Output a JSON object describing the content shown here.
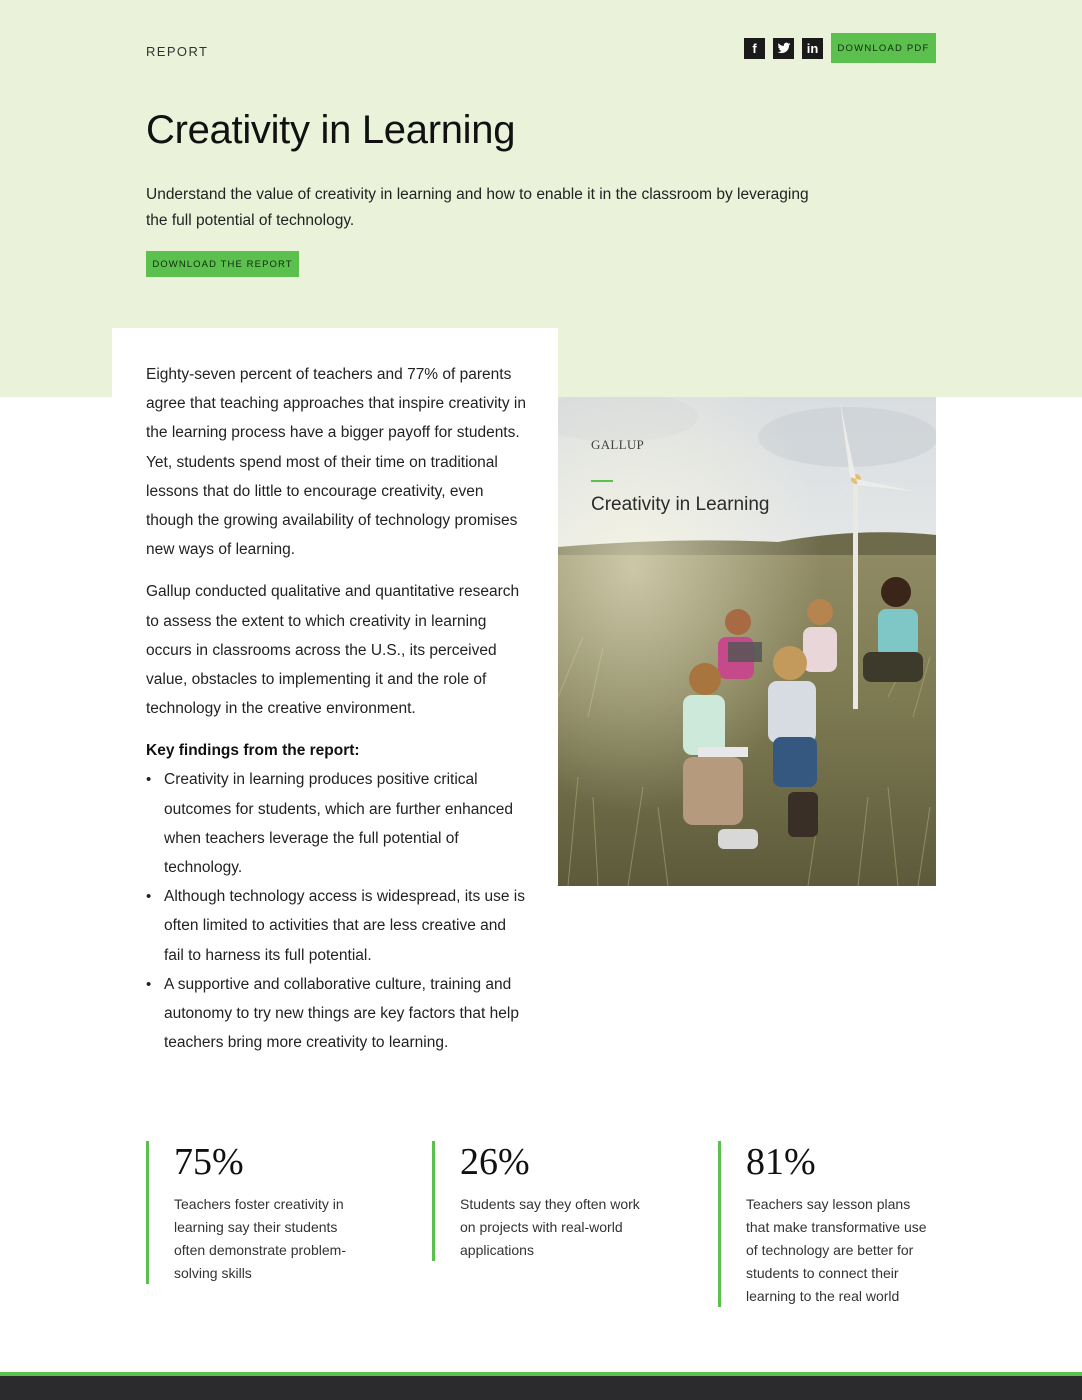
{
  "header": {
    "eyebrow": "REPORT",
    "social": [
      {
        "label": "f",
        "icon": "facebook-icon"
      },
      {
        "label": "twitter",
        "icon": "twitter-icon"
      },
      {
        "label": "in",
        "icon": "linkedin-icon"
      }
    ],
    "download_pdf_label": "DOWNLOAD PDF"
  },
  "hero": {
    "title": "Creativity in Learning",
    "intro": "Understand the value of creativity in learning and how to enable it in the classroom by leveraging the full potential of technology.",
    "download_report_label": "DOWNLOAD THE REPORT"
  },
  "body": {
    "paragraphs": [
      "Eighty-seven percent of teachers and 77% of parents agree that teaching approaches that inspire creativity in the learning process have a bigger payoff for students. Yet, students spend most of their time on traditional lessons that do little to encourage creativity, even though the growing availability of technology promises new ways of learning.",
      "Gallup conducted qualitative and quantitative research to assess the extent to which creativity in learning occurs in classrooms across the U.S., its perceived value, obstacles to implementing it and the role of technology in the creative environment."
    ],
    "findings_heading": "Key findings from the report:",
    "findings": [
      "Creativity in learning produces positive critical outcomes for students, which are further enhanced when teachers leverage the full potential of technology.",
      "Although technology access is widespread, its use is often limited to activities that are less creative and fail to harness its full potential.",
      "A supportive and collaborative culture, training and autonomy to try new things are key factors that help teachers bring more creativity to learning."
    ]
  },
  "cover": {
    "brand": "GALLUP",
    "title": "Creativity in Learning"
  },
  "stats": [
    {
      "value": "75%",
      "description": "Teachers foster creativity in learning say their students often demonstrate problem-solving skills"
    },
    {
      "value": "26%",
      "description": "Students say they often work on projects with real-world applications"
    },
    {
      "value": "81%",
      "description": "Teachers say lesson plans that make transformative use of technology are better for students to connect their learning to the real world"
    }
  ],
  "colors": {
    "hero_bg": "#eaf3da",
    "accent": "#5cc04f",
    "footer": "#2b2b2d"
  }
}
